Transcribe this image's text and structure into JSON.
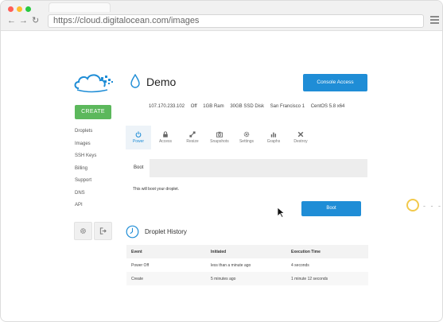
{
  "browser": {
    "url": "https://cloud.digitalocean.com/images"
  },
  "sidebar": {
    "create_label": "CREATE",
    "items": [
      {
        "label": "Droplets"
      },
      {
        "label": "Images"
      },
      {
        "label": "SSH Keys"
      },
      {
        "label": "Billing"
      },
      {
        "label": "Support"
      },
      {
        "label": "DNS"
      },
      {
        "label": "API"
      }
    ]
  },
  "droplet": {
    "name": "Demo",
    "console_label": "Console Access",
    "ip": "107.170.233.102",
    "status": "Off",
    "ram": "1GB Ram",
    "disk": "30GB SSD Disk",
    "region": "San Francisco 1",
    "os": "CentOS 5.8 x64"
  },
  "tabs": [
    {
      "label": "Power",
      "icon": "power-icon"
    },
    {
      "label": "Access",
      "icon": "lock-icon"
    },
    {
      "label": "Resize",
      "icon": "resize-icon"
    },
    {
      "label": "Snapshots",
      "icon": "camera-icon"
    },
    {
      "label": "Settings",
      "icon": "gear-icon"
    },
    {
      "label": "Graphs",
      "icon": "bar-chart-icon"
    },
    {
      "label": "Destroy",
      "icon": "close-icon"
    }
  ],
  "boot": {
    "label": "Boot",
    "description": "This will boot your droplet.",
    "button_label": "Boot"
  },
  "history": {
    "title": "Droplet History",
    "columns": [
      "Event",
      "Initiated",
      "Execution Time"
    ],
    "rows": [
      [
        "Power Off",
        "less than a minute ago",
        "4 seconds"
      ],
      [
        "Create",
        "5 minutes ago",
        "1 minute 12 seconds"
      ]
    ]
  },
  "colors": {
    "primary": "#1f8dd6",
    "create": "#5cb85c",
    "accent_ring": "#f2c94c"
  }
}
